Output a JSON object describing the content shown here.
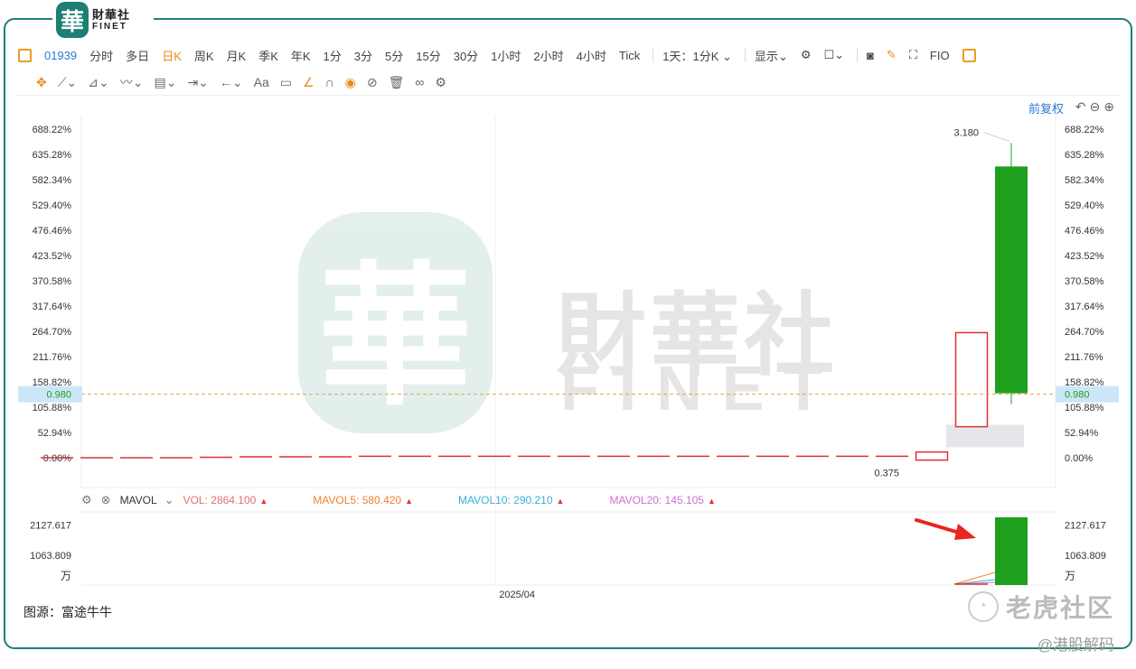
{
  "logo": {
    "cn": "財華社",
    "en": "FINET",
    "seal": "華"
  },
  "toolbar": {
    "code": "01939",
    "periods": [
      "分时",
      "多日",
      "日K",
      "周K",
      "月K",
      "季K",
      "年K",
      "1分",
      "3分",
      "5分",
      "15分",
      "30分",
      "1小时",
      "2小时",
      "4小时",
      "Tick"
    ],
    "active_period": "日K",
    "interval": "1天：1分K",
    "display": "显示",
    "fio": "FIO"
  },
  "drawing_tools": {
    "text_tool": "Aa"
  },
  "fuquan": "前复权",
  "watermark": {
    "cn": "財華社",
    "en": "FINET",
    "seal": "華"
  },
  "colors": {
    "up": "#1ea01e",
    "down": "#e03030",
    "price_line": "#f0a040",
    "price_tag_bg": "#cce6f8",
    "ma5": "#f08030",
    "ma10": "#3aaed8",
    "ma20": "#d070d0"
  },
  "chart_data": [
    {
      "type": "candlestick",
      "y_axis_unit": "%",
      "y_ticks": [
        "688.22%",
        "635.28%",
        "582.34%",
        "529.40%",
        "476.46%",
        "423.52%",
        "370.58%",
        "317.64%",
        "264.70%",
        "211.76%",
        "158.82%",
        "105.88%",
        "52.94%",
        "0.00%"
      ],
      "y_tick_values": [
        688.22,
        635.28,
        582.34,
        529.4,
        476.46,
        423.52,
        370.58,
        317.64,
        264.7,
        211.76,
        158.82,
        105.88,
        52.94,
        0.0
      ],
      "ylim": [
        0,
        688.22
      ],
      "current_price": "0.980",
      "current_price_pct": 133,
      "max_label": "3.180",
      "min_label": "0.375",
      "x_label": "2025/04",
      "x_label_fraction": 0.425,
      "candles": [
        {
          "o": 0,
          "c": 0,
          "h": 0,
          "l": 0
        },
        {
          "o": 0,
          "c": 0,
          "h": 0,
          "l": 0
        },
        {
          "o": 0,
          "c": 0,
          "h": 0,
          "l": 0
        },
        {
          "o": 0,
          "c": 0,
          "h": 0,
          "l": 0
        },
        {
          "o": 1,
          "c": 1,
          "h": 1,
          "l": 1
        },
        {
          "o": 2,
          "c": 2,
          "h": 2,
          "l": 2
        },
        {
          "o": 2,
          "c": 2,
          "h": 2,
          "l": 2
        },
        {
          "o": 2,
          "c": 2,
          "h": 2,
          "l": 2
        },
        {
          "o": 3,
          "c": 3,
          "h": 3,
          "l": 3
        },
        {
          "o": 3,
          "c": 3,
          "h": 3,
          "l": 3
        },
        {
          "o": 3,
          "c": 3,
          "h": 3,
          "l": 3
        },
        {
          "o": 3,
          "c": 3,
          "h": 3,
          "l": 3
        },
        {
          "o": 3,
          "c": 3,
          "h": 3,
          "l": 3
        },
        {
          "o": 3,
          "c": 3,
          "h": 3,
          "l": 3
        },
        {
          "o": 3,
          "c": 3,
          "h": 3,
          "l": 3
        },
        {
          "o": 3,
          "c": 3,
          "h": 3,
          "l": 3
        },
        {
          "o": 3,
          "c": 3,
          "h": 3,
          "l": 3
        },
        {
          "o": 3,
          "c": 3,
          "h": 3,
          "l": 3
        },
        {
          "o": 3,
          "c": 3,
          "h": 3,
          "l": 3
        },
        {
          "o": 3,
          "c": 3,
          "h": 3,
          "l": 3
        },
        {
          "o": 3,
          "c": 3,
          "h": 3,
          "l": 3
        },
        {
          "o": 3,
          "c": 3,
          "h": 3,
          "l": 3
        },
        {
          "o": -5,
          "c": 12,
          "h": 12,
          "l": -5
        },
        {
          "o": 65,
          "c": 262,
          "h": 262,
          "l": 65
        },
        {
          "o": 135,
          "c": 610,
          "h": 659,
          "l": 112
        }
      ],
      "band": {
        "from": 22,
        "to": 69
      }
    },
    {
      "type": "bar",
      "title": "MAVOL",
      "vol_label": "VOL: 2864.100",
      "ma5_label": "MAVOL5: 580.420",
      "ma10_label": "MAVOL10: 290.210",
      "ma20_label": "MAVOL20: 145.105",
      "y_ticks": [
        "2127.617",
        "1063.809"
      ],
      "y_tick_values": [
        2127.617,
        1063.809
      ],
      "unit": "万",
      "ylim": [
        0,
        2600
      ],
      "last_volume": 2864.1
    }
  ],
  "footer": {
    "source": "图源：富途牛牛",
    "brand": "老虎社区",
    "handle": "@港股解码"
  }
}
